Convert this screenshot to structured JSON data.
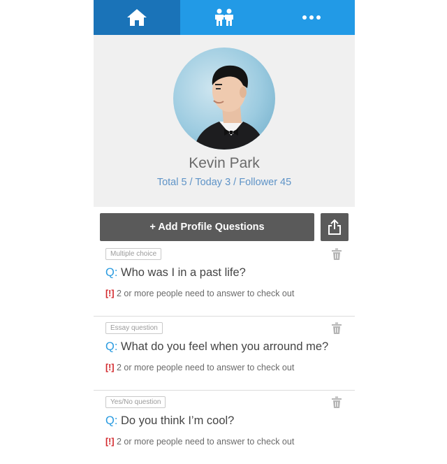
{
  "nav": {
    "tabs": [
      {
        "name": "home",
        "icon": "home-icon",
        "active": true
      },
      {
        "name": "friends",
        "icon": "friends-icon",
        "active": false
      },
      {
        "name": "more",
        "icon": "more-icon",
        "active": false
      }
    ]
  },
  "profile": {
    "name": "Kevin Park",
    "stats": "Total 5 / Today 3 / Follower 45"
  },
  "actions": {
    "add_label": "+ Add Profile Questions",
    "share_icon": "share-icon"
  },
  "questions": [
    {
      "tag": "Multiple choice",
      "prefix": "Q",
      "text": "Who was I in a past life?",
      "warn": "[!]",
      "note": "2 or more people need to answer to check out"
    },
    {
      "tag": "Essay question",
      "prefix": "Q",
      "text": "What do you feel when you arround me?",
      "warn": "[!]",
      "note": "2 or more people need to answer to check out"
    },
    {
      "tag": "Yes/No question",
      "prefix": "Q",
      "text": "Do you think I’m cool?",
      "warn": "[!]",
      "note": "2 or more people need to answer to check out"
    }
  ],
  "colors": {
    "nav_active": "#1a73b8",
    "nav_bg": "#229ae6",
    "stats_blue": "#5e93c7",
    "question_blue": "#2a9be0",
    "warn_red": "#d2272b",
    "button_gray": "#5a5a5a"
  }
}
